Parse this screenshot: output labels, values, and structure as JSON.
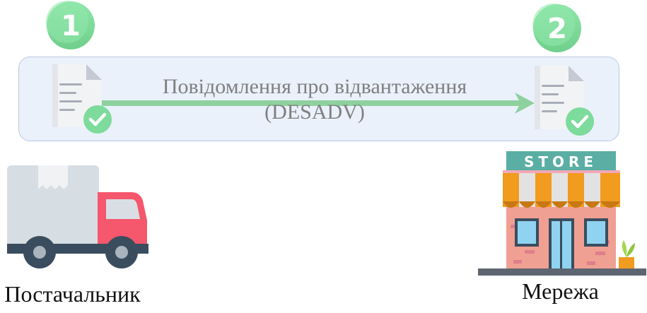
{
  "steps": [
    "1",
    "2"
  ],
  "message": {
    "line1": "Повідомлення про відвантаження",
    "line2": "(DESADV)"
  },
  "supplier_label": "Постачальник",
  "network_label": "Мережа",
  "store_sign": "STORE",
  "colors": {
    "badge_green": "#7ddb9b",
    "arrow_green": "#8fd19e",
    "panel_fill": "#eaf1fb",
    "panel_border": "#b9c9e2",
    "truck_cab": "#f5576c",
    "truck_box": "#d6dde3",
    "store_awning_orange": "#f19b1f",
    "store_sign_teal": "#5aaea3",
    "store_wall": "#f0a092"
  }
}
